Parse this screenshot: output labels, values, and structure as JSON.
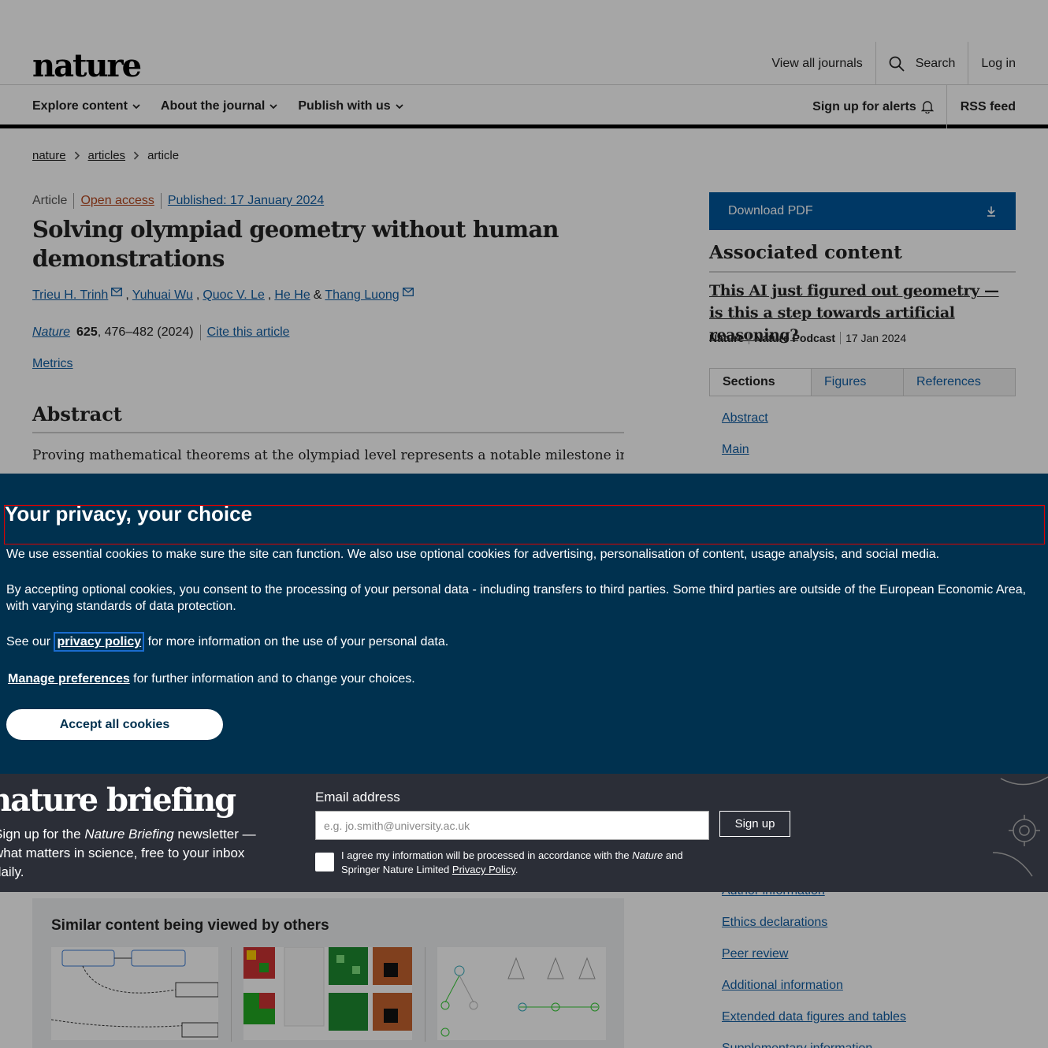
{
  "header": {
    "logo": "nature",
    "view_all": "View all journals",
    "search": "Search",
    "login": "Log in"
  },
  "nav": {
    "explore": "Explore content",
    "about": "About the journal",
    "publish": "Publish with us",
    "alerts": "Sign up for alerts",
    "rss": "RSS feed"
  },
  "breadcrumb": [
    "nature",
    "articles",
    "article"
  ],
  "article": {
    "type": "Article",
    "access": "Open access",
    "published": "Published: 17 January 2024",
    "title": "Solving olympiad geometry without human demonstrations",
    "authors": [
      "Trieu H. Trinh",
      "Yuhuai Wu",
      "Quoc V. Le",
      "He He",
      "Thang Luong"
    ],
    "author_sep_amp": "&",
    "journal": "Nature",
    "volume": "625",
    "pages": ", 476–482 (2024)",
    "cite": "Cite this article",
    "metrics": "Metrics",
    "abstract_heading": "Abstract",
    "abstract_line1": "Proving mathematical theorems at the olympiad level represents a notable milestone in"
  },
  "sidebar": {
    "download": "Download PDF",
    "assoc_heading": "Associated content",
    "assoc_link": "This AI just figured out geometry — is this a step towards artificial reasoning?",
    "assoc_source1": "Nature",
    "assoc_source2": "Nature Podcast",
    "assoc_date": "17 Jan 2024",
    "tabs": [
      "Sections",
      "Figures",
      "References"
    ],
    "sections_top": [
      "Abstract",
      "Main"
    ],
    "sections_bottom": [
      "Author information",
      "Ethics declarations",
      "Peer review",
      "Additional information",
      "Extended data figures and tables",
      "Supplementary information"
    ]
  },
  "similar": {
    "heading": "Similar content being viewed by others"
  },
  "briefing": {
    "logo": "nature briefing",
    "text_pre": "Sign up for the ",
    "text_em": "Nature Briefing",
    "text_post": " newsletter — what matters in science, free to your inbox daily.",
    "email_label": "Email address",
    "email_placeholder": "e.g. jo.smith@university.ac.uk",
    "signup": "Sign up",
    "agree_pre": "I agree my information will be processed in accordance with the ",
    "agree_em": "Nature",
    "agree_mid": " and Springer Nature Limited ",
    "agree_link": "Privacy Policy",
    "agree_post": "."
  },
  "cookie": {
    "title": "Your privacy, your choice",
    "p1": "We use essential cookies to make sure the site can function. We also use optional cookies for advertising, personalisation of content, usage analysis, and social media.",
    "p2": "By accepting optional cookies, you consent to the processing of your personal data - including transfers to third parties. Some third parties are outside of the European Economic Area, with varying standards of data protection.",
    "p3_pre": "See our ",
    "p3_link": "privacy policy",
    "p3_post": " for more information on the use of your personal data.",
    "p4_link": "Manage preferences",
    "p4_post": " for further information and to change your choices.",
    "accept": "Accept all cookies"
  },
  "colors": {
    "cookie_bg": "#00314f",
    "briefing_bg": "#2b2e37",
    "download_bg": "#01579b",
    "link": "#125fa4",
    "open_access": "#b64820"
  }
}
